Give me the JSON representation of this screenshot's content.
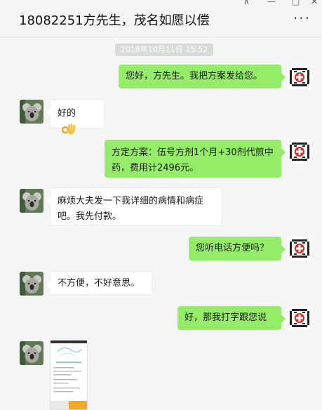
{
  "window": {
    "title": "18082251方先生，茂名如愿以偿",
    "controls": {
      "pin": "⊼",
      "minimize": "—",
      "maximize": "□",
      "close": "✕"
    },
    "more": "···"
  },
  "chat": {
    "timestamp": "2018年10月11日 15:52",
    "messages": [
      {
        "from": "me",
        "text": "您好，方先生。我把方案发给您。"
      },
      {
        "from": "them",
        "text": "好的",
        "emoji": "ok-hand"
      },
      {
        "from": "me",
        "text": "方定方案：伍号方剂1个月+30剂代煎中药，费用计2496元。"
      },
      {
        "from": "them",
        "text": "麻烦大夫发一下我详细的病情和病症吧。我先付款。"
      },
      {
        "from": "me",
        "text": "您听电话方便吗？"
      },
      {
        "from": "them",
        "text": "不方便，不好意思。"
      },
      {
        "from": "me",
        "text": "好，那我打字跟您说"
      },
      {
        "from": "them",
        "type": "image",
        "text": ""
      }
    ]
  },
  "colors": {
    "sent_bubble": "#95ec69",
    "received_bubble": "#ffffff",
    "background": "#f5f5f5",
    "logo_red": "#d7302c"
  }
}
